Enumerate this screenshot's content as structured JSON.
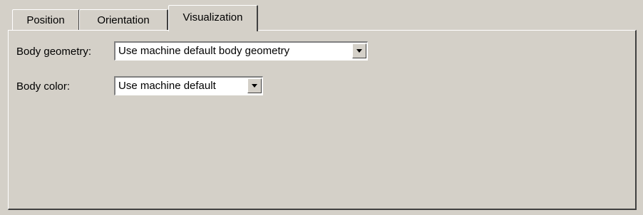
{
  "tabs": [
    {
      "label": "Position"
    },
    {
      "label": "Orientation"
    },
    {
      "label": "Visualization",
      "active": true
    }
  ],
  "fields": {
    "body_geometry": {
      "label": "Body geometry:",
      "value": "Use machine default body geometry",
      "button_icon": "chevron-down-icon"
    },
    "body_color": {
      "label": "Body color:",
      "value": "Use machine default",
      "button_icon": "chevron-down-icon"
    }
  },
  "colors": {
    "face": "#d4d0c8",
    "highlight": "#ffffff",
    "shadow": "#404040"
  }
}
